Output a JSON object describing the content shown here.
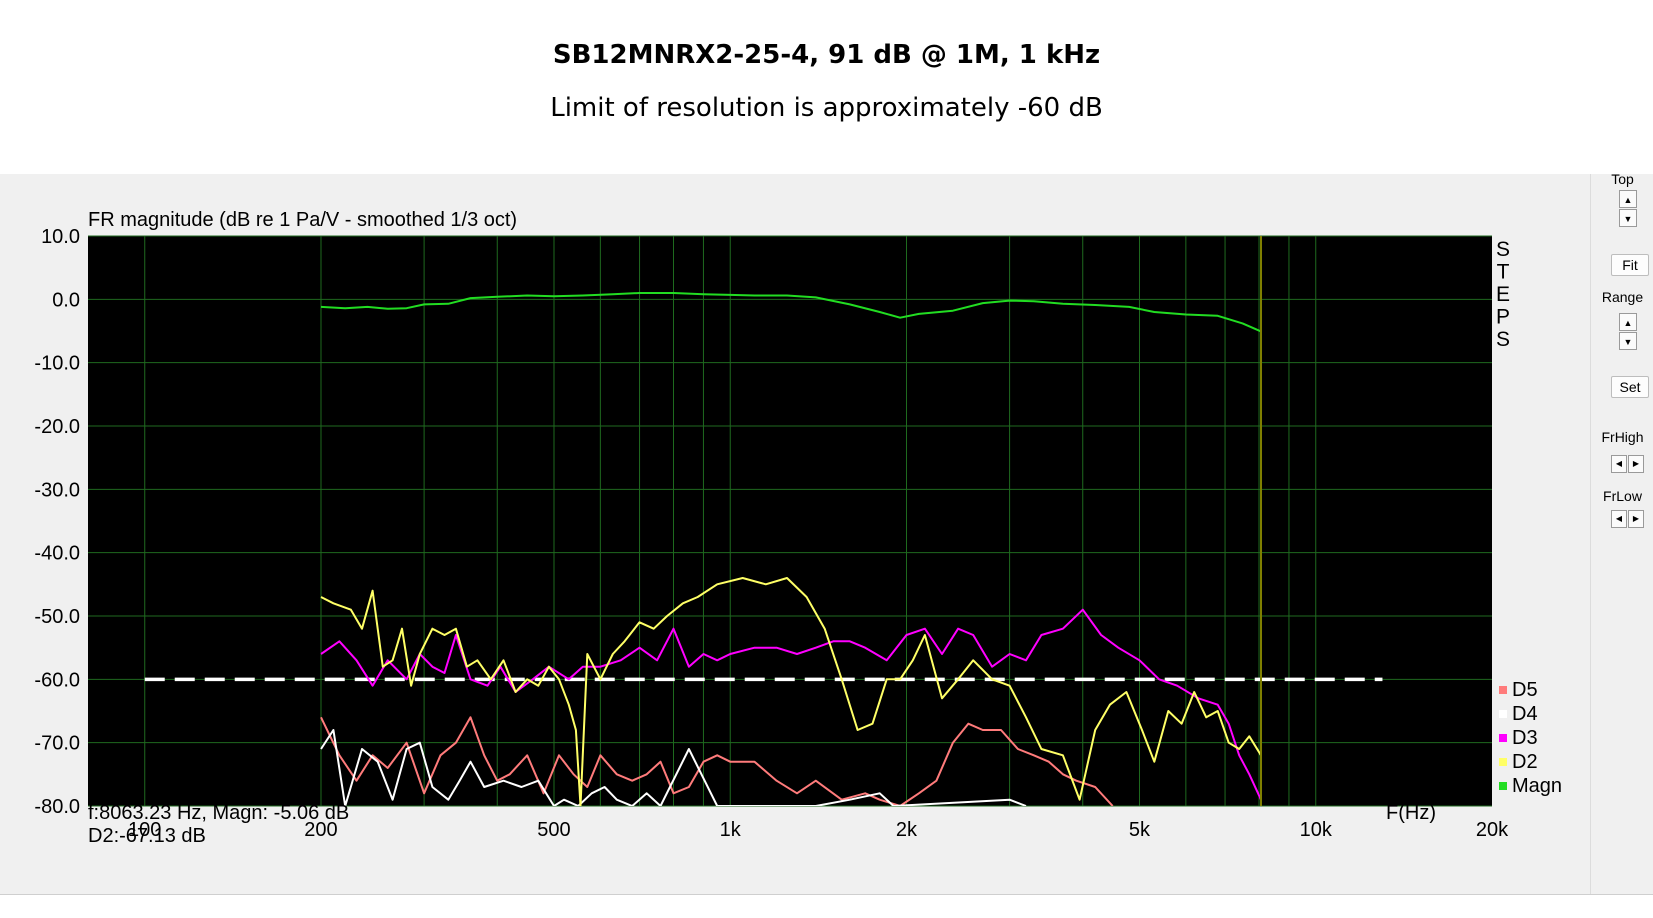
{
  "header": {
    "title": "SB12MNRX2-25-4, 91 dB @ 1M, 1 kHz",
    "subtitle": "Limit of resolution is approximately -60 dB"
  },
  "sidebar": {
    "top_label": "Top",
    "fit_label": "Fit",
    "range_label": "Range",
    "set_label": "Set",
    "frhigh_label": "FrHigh",
    "frlow_label": "FrLow",
    "up_glyph": "▲",
    "down_glyph": "▼",
    "left_glyph": "◀",
    "right_glyph": "▶"
  },
  "readout": {
    "line1": "f:8063.23 Hz, Magn: -5.06 dB",
    "line2": "D2:-67.13 dB"
  },
  "colors": {
    "plot_bg": "#000000",
    "grid": "#1f6a1f",
    "Magn": "#22dd22",
    "D2": "#ffff66",
    "D3": "#ff00ff",
    "D4": "#ffffff",
    "D5": "#ff7b7b",
    "cursor": "#808000",
    "limit_line": "#ffffff"
  },
  "chart_data": {
    "type": "line",
    "title": "FR magnitude (dB re 1 Pa/V - smoothed 1/3 oct)",
    "xlabel": "F(Hz)",
    "ylabel": "",
    "x_scale": "log",
    "xlim": [
      80,
      20000
    ],
    "ylim": [
      -80,
      10
    ],
    "grid": true,
    "legend_position": "right",
    "steps_label": "STEPS",
    "y_ticks": [
      "10.0",
      "0.0",
      "-10.0",
      "-20.0",
      "-30.0",
      "-40.0",
      "-50.0",
      "-60.0",
      "-70.0",
      "-80.0"
    ],
    "x_ticks": [
      {
        "value": 100,
        "label": "100"
      },
      {
        "value": 200,
        "label": "200"
      },
      {
        "value": 500,
        "label": "500"
      },
      {
        "value": 1000,
        "label": "1k"
      },
      {
        "value": 2000,
        "label": "2k"
      },
      {
        "value": 5000,
        "label": "5k"
      },
      {
        "value": 10000,
        "label": "10k"
      },
      {
        "value": 20000,
        "label": "20k"
      }
    ],
    "cursor_hz": 8063.23,
    "reference_line": {
      "y": -60,
      "x_start": 100,
      "x_end": 13000,
      "style": "dashed"
    },
    "legend": [
      "D5",
      "D4",
      "D3",
      "D2",
      "Magn"
    ],
    "series": [
      {
        "name": "Magn",
        "points": [
          [
            200,
            -1.2
          ],
          [
            220,
            -1.4
          ],
          [
            240,
            -1.2
          ],
          [
            260,
            -1.5
          ],
          [
            280,
            -1.4
          ],
          [
            300,
            -0.8
          ],
          [
            330,
            -0.7
          ],
          [
            360,
            0.2
          ],
          [
            400,
            0.4
          ],
          [
            450,
            0.6
          ],
          [
            500,
            0.5
          ],
          [
            560,
            0.6
          ],
          [
            630,
            0.8
          ],
          [
            700,
            1.0
          ],
          [
            800,
            1.0
          ],
          [
            900,
            0.8
          ],
          [
            1000,
            0.7
          ],
          [
            1100,
            0.6
          ],
          [
            1250,
            0.6
          ],
          [
            1400,
            0.3
          ],
          [
            1600,
            -0.8
          ],
          [
            1800,
            -2.0
          ],
          [
            1950,
            -2.9
          ],
          [
            2100,
            -2.3
          ],
          [
            2400,
            -1.8
          ],
          [
            2700,
            -0.6
          ],
          [
            3000,
            -0.2
          ],
          [
            3300,
            -0.3
          ],
          [
            3700,
            -0.7
          ],
          [
            4200,
            -0.9
          ],
          [
            4800,
            -1.2
          ],
          [
            5300,
            -2.0
          ],
          [
            6000,
            -2.4
          ],
          [
            6800,
            -2.6
          ],
          [
            7500,
            -3.8
          ],
          [
            8063,
            -5.06
          ]
        ]
      },
      {
        "name": "D2",
        "points": [
          [
            200,
            -47
          ],
          [
            210,
            -48
          ],
          [
            225,
            -49
          ],
          [
            235,
            -52
          ],
          [
            245,
            -46
          ],
          [
            255,
            -58
          ],
          [
            265,
            -57
          ],
          [
            275,
            -52
          ],
          [
            285,
            -61
          ],
          [
            295,
            -56
          ],
          [
            310,
            -52
          ],
          [
            325,
            -53
          ],
          [
            340,
            -52
          ],
          [
            355,
            -58
          ],
          [
            370,
            -57
          ],
          [
            390,
            -60
          ],
          [
            410,
            -57
          ],
          [
            430,
            -62
          ],
          [
            450,
            -60
          ],
          [
            470,
            -61
          ],
          [
            490,
            -58
          ],
          [
            510,
            -60
          ],
          [
            530,
            -64
          ],
          [
            545,
            -68
          ],
          [
            555,
            -80
          ],
          [
            570,
            -56
          ],
          [
            600,
            -60
          ],
          [
            630,
            -56
          ],
          [
            660,
            -54
          ],
          [
            700,
            -51
          ],
          [
            740,
            -52
          ],
          [
            780,
            -50
          ],
          [
            830,
            -48
          ],
          [
            880,
            -47
          ],
          [
            950,
            -45
          ],
          [
            1050,
            -44
          ],
          [
            1150,
            -45
          ],
          [
            1250,
            -44
          ],
          [
            1350,
            -47
          ],
          [
            1450,
            -52
          ],
          [
            1550,
            -60
          ],
          [
            1650,
            -68
          ],
          [
            1750,
            -67
          ],
          [
            1850,
            -60
          ],
          [
            1950,
            -60
          ],
          [
            2050,
            -57
          ],
          [
            2150,
            -53
          ],
          [
            2300,
            -63
          ],
          [
            2450,
            -60
          ],
          [
            2600,
            -57
          ],
          [
            2800,
            -60
          ],
          [
            3000,
            -61
          ],
          [
            3200,
            -66
          ],
          [
            3400,
            -71
          ],
          [
            3700,
            -72
          ],
          [
            3950,
            -79
          ],
          [
            4200,
            -68
          ],
          [
            4450,
            -64
          ],
          [
            4750,
            -62
          ],
          [
            5050,
            -68
          ],
          [
            5300,
            -73
          ],
          [
            5600,
            -65
          ],
          [
            5900,
            -67
          ],
          [
            6200,
            -62
          ],
          [
            6500,
            -66
          ],
          [
            6800,
            -65
          ],
          [
            7100,
            -70
          ],
          [
            7400,
            -71
          ],
          [
            7700,
            -69
          ],
          [
            8063,
            -72
          ]
        ]
      },
      {
        "name": "D3",
        "points": [
          [
            200,
            -56
          ],
          [
            215,
            -54
          ],
          [
            230,
            -57
          ],
          [
            245,
            -61
          ],
          [
            260,
            -57
          ],
          [
            280,
            -60
          ],
          [
            295,
            -56
          ],
          [
            310,
            -58
          ],
          [
            325,
            -59
          ],
          [
            340,
            -53
          ],
          [
            360,
            -60
          ],
          [
            385,
            -61
          ],
          [
            405,
            -58
          ],
          [
            430,
            -62
          ],
          [
            460,
            -60
          ],
          [
            490,
            -58
          ],
          [
            530,
            -60
          ],
          [
            560,
            -58
          ],
          [
            600,
            -58
          ],
          [
            650,
            -57
          ],
          [
            700,
            -55
          ],
          [
            750,
            -57
          ],
          [
            800,
            -52
          ],
          [
            850,
            -58
          ],
          [
            900,
            -56
          ],
          [
            950,
            -57
          ],
          [
            1000,
            -56
          ],
          [
            1100,
            -55
          ],
          [
            1200,
            -55
          ],
          [
            1300,
            -56
          ],
          [
            1400,
            -55
          ],
          [
            1500,
            -54
          ],
          [
            1600,
            -54
          ],
          [
            1700,
            -55
          ],
          [
            1850,
            -57
          ],
          [
            2000,
            -53
          ],
          [
            2150,
            -52
          ],
          [
            2300,
            -56
          ],
          [
            2450,
            -52
          ],
          [
            2600,
            -53
          ],
          [
            2800,
            -58
          ],
          [
            3000,
            -56
          ],
          [
            3200,
            -57
          ],
          [
            3400,
            -53
          ],
          [
            3700,
            -52
          ],
          [
            4000,
            -49
          ],
          [
            4300,
            -53
          ],
          [
            4600,
            -55
          ],
          [
            5000,
            -57
          ],
          [
            5400,
            -60
          ],
          [
            5800,
            -61
          ],
          [
            6300,
            -63
          ],
          [
            6800,
            -64
          ],
          [
            7100,
            -67
          ],
          [
            7400,
            -72
          ],
          [
            7700,
            -75
          ],
          [
            8063,
            -79
          ]
        ]
      },
      {
        "name": "D4",
        "points": [
          [
            200,
            -71
          ],
          [
            210,
            -68
          ],
          [
            220,
            -80
          ],
          [
            235,
            -71
          ],
          [
            250,
            -73
          ],
          [
            265,
            -79
          ],
          [
            280,
            -71
          ],
          [
            295,
            -70
          ],
          [
            310,
            -77
          ],
          [
            330,
            -79
          ],
          [
            345,
            -76
          ],
          [
            360,
            -73
          ],
          [
            380,
            -77
          ],
          [
            410,
            -76
          ],
          [
            440,
            -77
          ],
          [
            470,
            -76
          ],
          [
            500,
            -80
          ],
          [
            520,
            -79
          ],
          [
            550,
            -80
          ],
          [
            580,
            -78
          ],
          [
            610,
            -77
          ],
          [
            640,
            -79
          ],
          [
            680,
            -80
          ],
          [
            720,
            -78
          ],
          [
            760,
            -80
          ],
          [
            850,
            -71
          ],
          [
            950,
            -80
          ],
          [
            1100,
            -80
          ],
          [
            1400,
            -80
          ],
          [
            1600,
            -79
          ],
          [
            1800,
            -78
          ],
          [
            1900,
            -80
          ],
          [
            3000,
            -79
          ],
          [
            3200,
            -80
          ]
        ]
      },
      {
        "name": "D5",
        "points": [
          [
            200,
            -66
          ],
          [
            215,
            -72
          ],
          [
            230,
            -76
          ],
          [
            245,
            -72
          ],
          [
            260,
            -74
          ],
          [
            280,
            -70
          ],
          [
            300,
            -78
          ],
          [
            320,
            -72
          ],
          [
            340,
            -70
          ],
          [
            360,
            -66
          ],
          [
            380,
            -72
          ],
          [
            400,
            -76
          ],
          [
            420,
            -75
          ],
          [
            450,
            -72
          ],
          [
            480,
            -78
          ],
          [
            510,
            -72
          ],
          [
            540,
            -75
          ],
          [
            570,
            -77
          ],
          [
            600,
            -72
          ],
          [
            640,
            -75
          ],
          [
            680,
            -76
          ],
          [
            720,
            -75
          ],
          [
            760,
            -73
          ],
          [
            800,
            -78
          ],
          [
            850,
            -77
          ],
          [
            900,
            -73
          ],
          [
            950,
            -72
          ],
          [
            1000,
            -73
          ],
          [
            1100,
            -73
          ],
          [
            1200,
            -76
          ],
          [
            1300,
            -78
          ],
          [
            1400,
            -76
          ],
          [
            1550,
            -79
          ],
          [
            1700,
            -78
          ],
          [
            1800,
            -79
          ],
          [
            1950,
            -80
          ],
          [
            2100,
            -78
          ],
          [
            2250,
            -76
          ],
          [
            2400,
            -70
          ],
          [
            2550,
            -67
          ],
          [
            2700,
            -68
          ],
          [
            2900,
            -68
          ],
          [
            3100,
            -71
          ],
          [
            3300,
            -72
          ],
          [
            3500,
            -73
          ],
          [
            3700,
            -75
          ],
          [
            3900,
            -76
          ],
          [
            4200,
            -77
          ],
          [
            4500,
            -80
          ]
        ]
      }
    ]
  }
}
